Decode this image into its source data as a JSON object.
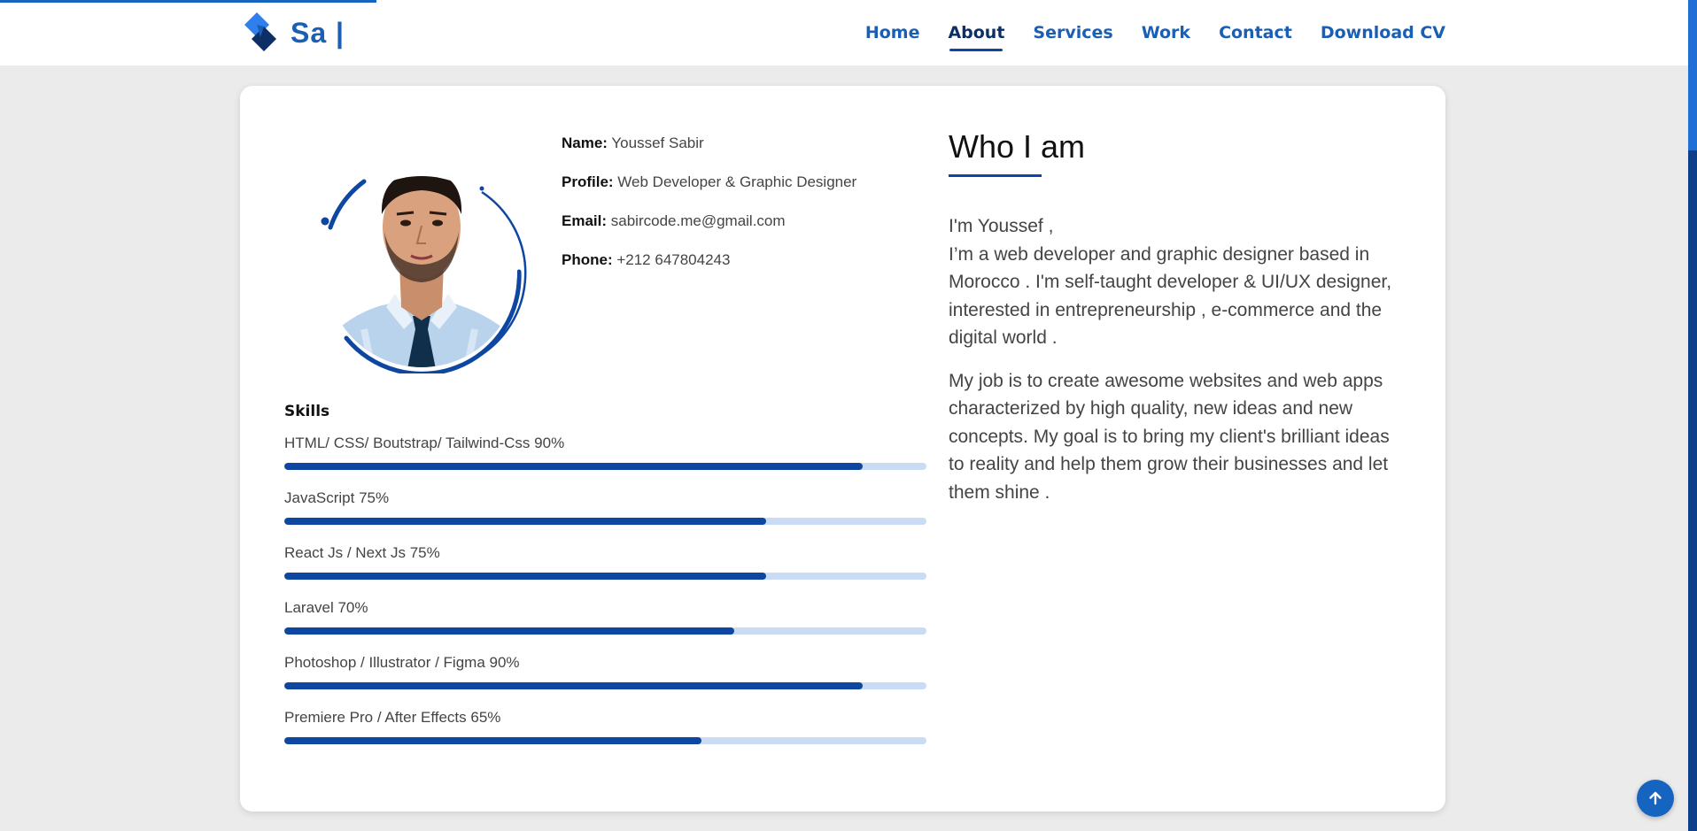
{
  "brand": {
    "text": "Sa |"
  },
  "nav": {
    "items": [
      {
        "label": "Home",
        "active": false
      },
      {
        "label": "About",
        "active": true
      },
      {
        "label": "Services",
        "active": false
      },
      {
        "label": "Work",
        "active": false
      },
      {
        "label": "Contact",
        "active": false
      },
      {
        "label": "Download CV",
        "active": false
      }
    ]
  },
  "profile": {
    "name_label": "Name:",
    "name_value": "Youssef Sabir",
    "profile_label": "Profile:",
    "profile_value": "Web Developer & Graphic Designer",
    "email_label": "Email:",
    "email_value": "sabircode.me@gmail.com",
    "phone_label": "Phone:",
    "phone_value": "+212 647804243"
  },
  "skills": {
    "title": "Skills",
    "items": [
      {
        "label": "HTML/ CSS/ Boutstrap/ Tailwind-Css 90%",
        "percent": 90
      },
      {
        "label": "JavaScript 75%",
        "percent": 75
      },
      {
        "label": "React Js / Next Js 75%",
        "percent": 75
      },
      {
        "label": "Laravel 70%",
        "percent": 70
      },
      {
        "label": "Photoshop / Illustrator / Figma 90%",
        "percent": 90
      },
      {
        "label": "Premiere Pro / After Effects 65%",
        "percent": 65
      }
    ]
  },
  "about": {
    "title": "Who I am",
    "paragraph1_line1": "I'm Youssef ,",
    "paragraph1_rest": "I’m a web developer and graphic designer based in Morocco . I'm self-taught developer & UI/UX designer, interested in entrepreneurship , e-commerce and the digital world .",
    "paragraph2": "My job is to create awesome websites and web apps characterized by high quality, new ideas and new concepts. My goal is to bring my client's brilliant ideas to reality and help them grow their businesses and let them shine ."
  },
  "colors": {
    "accent": "#1a5fb4",
    "accent_dark": "#0d47a1",
    "track": "#c9dcf4",
    "background": "#ebebeb"
  },
  "icons": {
    "logo": "diamond-logo-icon",
    "scroll_top": "arrow-up-icon"
  }
}
